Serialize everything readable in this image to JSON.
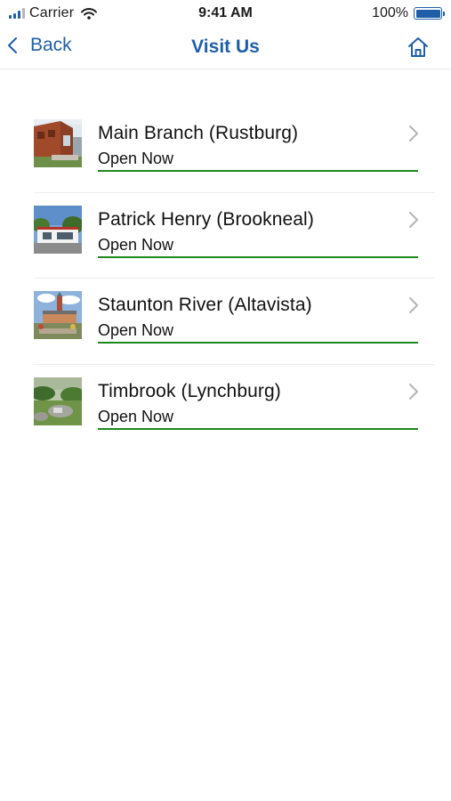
{
  "status_bar": {
    "carrier": "Carrier",
    "time": "9:41 AM",
    "battery": "100%",
    "icons": [
      "signal-icon",
      "wifi-icon",
      "battery-icon"
    ]
  },
  "nav": {
    "back_label": "Back",
    "title": "Visit Us",
    "home_icon": "home-icon"
  },
  "colors": {
    "accent": "#1f5fa8",
    "open_status": "#1e8a1e"
  },
  "branches": [
    {
      "name": "Main Branch (Rustburg)",
      "status": "Open Now"
    },
    {
      "name": "Patrick Henry (Brookneal)",
      "status": "Open Now"
    },
    {
      "name": "Staunton River (Altavista)",
      "status": "Open Now"
    },
    {
      "name": "Timbrook (Lynchburg)",
      "status": "Open Now"
    }
  ]
}
